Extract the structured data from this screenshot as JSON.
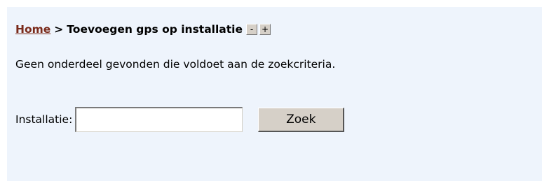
{
  "breadcrumb": {
    "home_label": "Home",
    "separator": ">",
    "current": "Toevoegen gps op installatie",
    "decrease_label": "-",
    "increase_label": "+"
  },
  "message": "Geen onderdeel gevonden die voldoet aan de zoekcriteria.",
  "search_form": {
    "label": "Installatie:",
    "input_value": "",
    "button_label": "Zoek"
  },
  "colors": {
    "panel_background": "#eef4fc",
    "home_link": "#7a2a1a",
    "button_face": "#d6d0c8"
  }
}
